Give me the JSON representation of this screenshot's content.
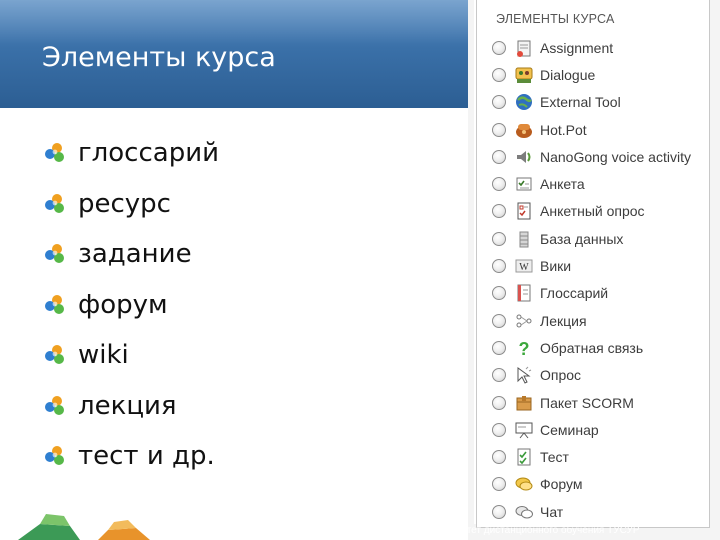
{
  "slide": {
    "title": "Элементы курса",
    "bullets": [
      "глоссарий",
      "ресурс",
      "задание",
      "форум",
      "wiki",
      "лекция",
      "тест и др."
    ],
    "caption": "Факультет дистанционного обучения ТУСУР"
  },
  "panel": {
    "header": "ЭЛЕМЕНТЫ КУРСА",
    "items": [
      {
        "label": "Assignment",
        "icon": "assignment-icon"
      },
      {
        "label": "Dialogue",
        "icon": "dialogue-icon"
      },
      {
        "label": "External Tool",
        "icon": "external-tool-icon"
      },
      {
        "label": "Hot.Pot",
        "icon": "hotpot-icon"
      },
      {
        "label": "NanoGong voice activity",
        "icon": "speaker-icon"
      },
      {
        "label": "Анкета",
        "icon": "survey-icon"
      },
      {
        "label": "Анкетный опрос",
        "icon": "questionnaire-icon"
      },
      {
        "label": "База данных",
        "icon": "database-icon"
      },
      {
        "label": "Вики",
        "icon": "wiki-icon"
      },
      {
        "label": "Глоссарий",
        "icon": "glossary-icon"
      },
      {
        "label": "Лекция",
        "icon": "lesson-icon"
      },
      {
        "label": "Обратная связь",
        "icon": "feedback-icon"
      },
      {
        "label": "Опрос",
        "icon": "choice-icon"
      },
      {
        "label": "Пакет SCORM",
        "icon": "scorm-icon"
      },
      {
        "label": "Семинар",
        "icon": "workshop-icon"
      },
      {
        "label": "Тест",
        "icon": "quiz-icon"
      },
      {
        "label": "Форум",
        "icon": "forum-icon"
      },
      {
        "label": "Чат",
        "icon": "chat-icon"
      }
    ]
  }
}
